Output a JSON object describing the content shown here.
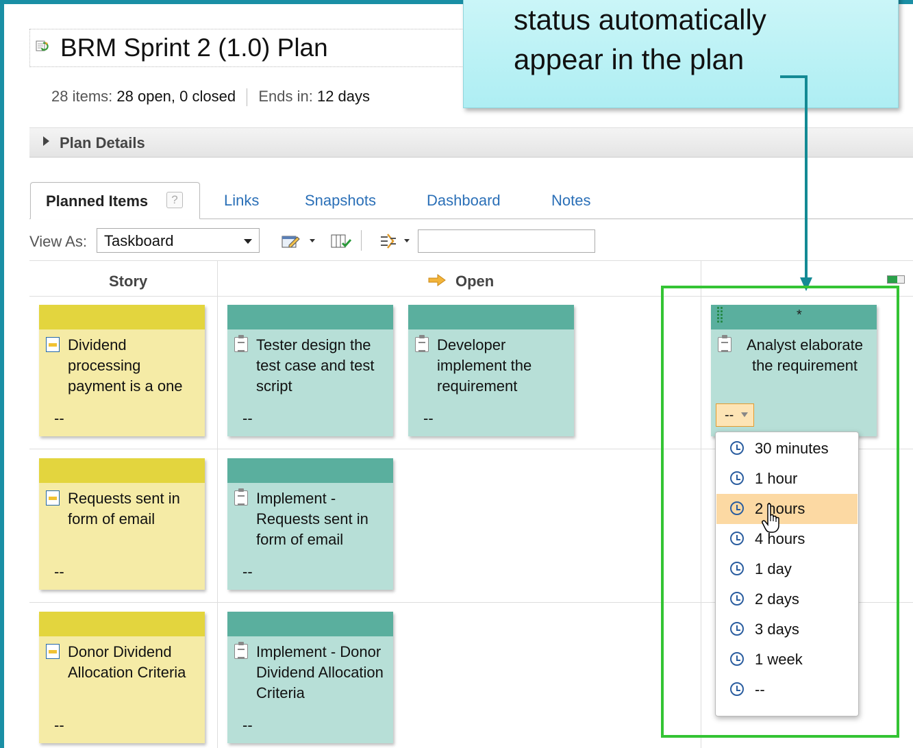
{
  "plan": {
    "title": "BRM Sprint 2 (1.0) Plan",
    "summary": {
      "items_label": "28 items:",
      "items_value": "28 open, 0 closed",
      "ends_label": "Ends in:",
      "ends_value": "12 days"
    },
    "details_label": "Plan Details"
  },
  "tabs": [
    {
      "label": "Planned Items",
      "active": true
    },
    {
      "label": "Links"
    },
    {
      "label": "Snapshots"
    },
    {
      "label": "Dashboard"
    },
    {
      "label": "Notes"
    }
  ],
  "help_glyph": "?",
  "toolbar": {
    "view_as_label": "View As:",
    "view_as_value": "Taskboard",
    "filter_value": ""
  },
  "board": {
    "columns": [
      "Story",
      "Open"
    ],
    "rows": [
      {
        "story": {
          "title": "Dividend processing payment is a one",
          "estimate": "--"
        },
        "tasks": [
          {
            "title": "Tester design the test case and test script",
            "estimate": "--"
          },
          {
            "title": "Developer implement the requirement",
            "estimate": "--"
          }
        ]
      },
      {
        "story": {
          "title": "Requests sent in form of email",
          "estimate": "--"
        },
        "tasks": [
          {
            "title": "Implement - Requests sent in form of email",
            "estimate": "--"
          }
        ]
      },
      {
        "story": {
          "title": "Donor Dividend Allocation Criteria",
          "estimate": "--"
        },
        "tasks": [
          {
            "title": "Implement - Donor Dividend Allocation Criteria",
            "estimate": "--"
          }
        ]
      }
    ],
    "new_card": {
      "marker": "*",
      "title": "Analyst elaborate the requirement",
      "estimate": "--"
    }
  },
  "estimate_menu": {
    "items": [
      "30 minutes",
      "1 hour",
      "2 hours",
      "4 hours",
      "1 day",
      "2 days",
      "3 days",
      "1 week",
      "--"
    ],
    "highlighted": "2 hours"
  },
  "callout": {
    "lines": [
      "status automatically",
      "appear in the plan"
    ]
  },
  "colors": {
    "frame": "#1a8fa5",
    "story_band": "#e3d53e",
    "story_body": "#f5eba6",
    "task_band": "#5aaf9e",
    "task_body": "#b7dfd7",
    "highlight_box": "#34c434",
    "link": "#2a6fb7",
    "menu_highlight": "#fcd9a3"
  },
  "icons": [
    "refresh-plan-icon",
    "help-icon",
    "edit-icon",
    "columns-icon",
    "filter-icon",
    "open-arrow-icon",
    "story-icon",
    "task-icon",
    "clock-icon",
    "hand-cursor-icon",
    "column-toggle-icon",
    "drag-grip-icon"
  ]
}
